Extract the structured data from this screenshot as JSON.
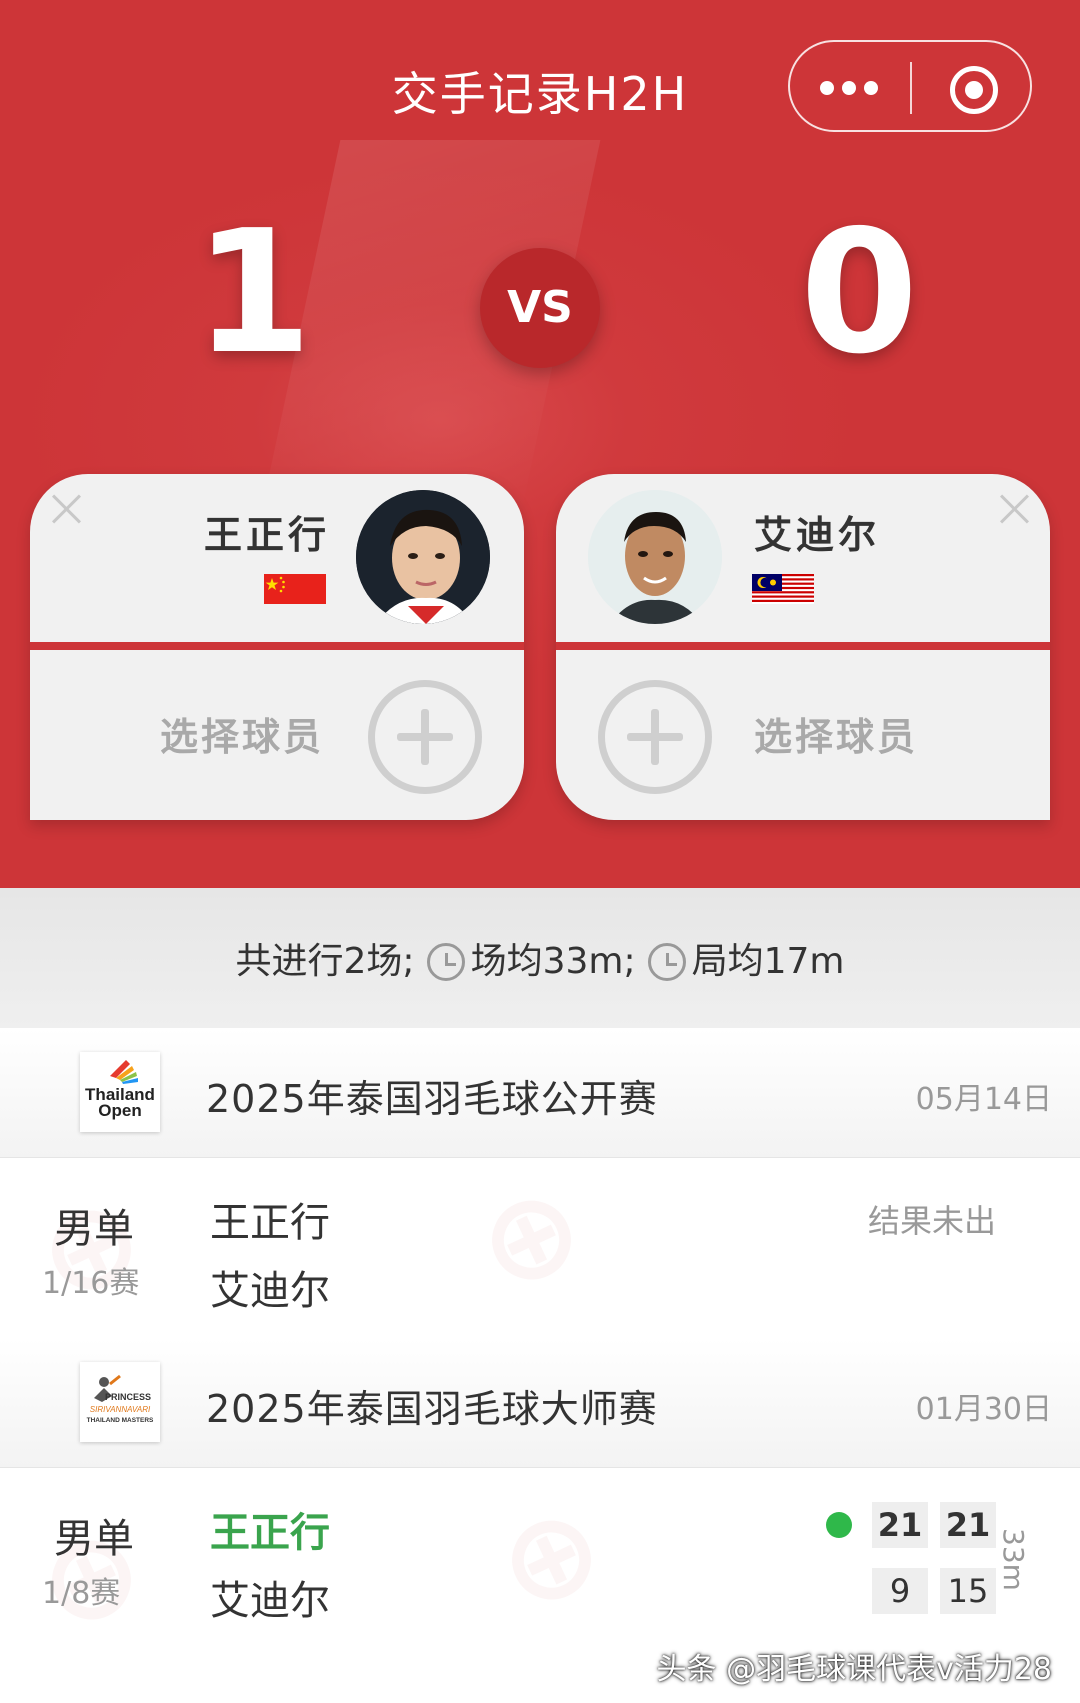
{
  "header": {
    "title": "交手记录H2H",
    "menu_icon": "more-dots-icon",
    "close_icon": "target-circle-icon"
  },
  "score": {
    "left": "1",
    "vs": "VS",
    "right": "0"
  },
  "players": {
    "left": {
      "name": "王正行",
      "flag": "China",
      "select_label": "选择球员"
    },
    "right": {
      "name": "艾迪尔",
      "flag": "Malaysia",
      "select_label": "选择球员"
    }
  },
  "stats": {
    "total": "共进行2场;",
    "avg_match": "场均33m;",
    "avg_game": "局均17m"
  },
  "matches": [
    {
      "event": "2025年泰国羽毛球公开赛",
      "logo_text": [
        "Thailand",
        "Open"
      ],
      "date": "05月14日",
      "type": "男单",
      "round": "1/16赛",
      "player1": "王正行",
      "player2": "艾迪尔",
      "result": "结果未出"
    },
    {
      "event": "2025年泰国羽毛球大师赛",
      "logo_text": [
        "PRINCESS",
        "SIRIVANNAVARI",
        "THAILAND MASTERS"
      ],
      "date": "01月30日",
      "type": "男单",
      "round": "1/8赛",
      "player1": "王正行",
      "player2": "艾迪尔",
      "scores_p1": [
        "21",
        "21"
      ],
      "scores_p2": [
        "9",
        "15"
      ],
      "duration": "33m"
    }
  ],
  "credit": "头条 @羽毛球课代表v活力28",
  "colors": {
    "brand_red": "#cd3538",
    "win_green": "#3aa44d"
  }
}
